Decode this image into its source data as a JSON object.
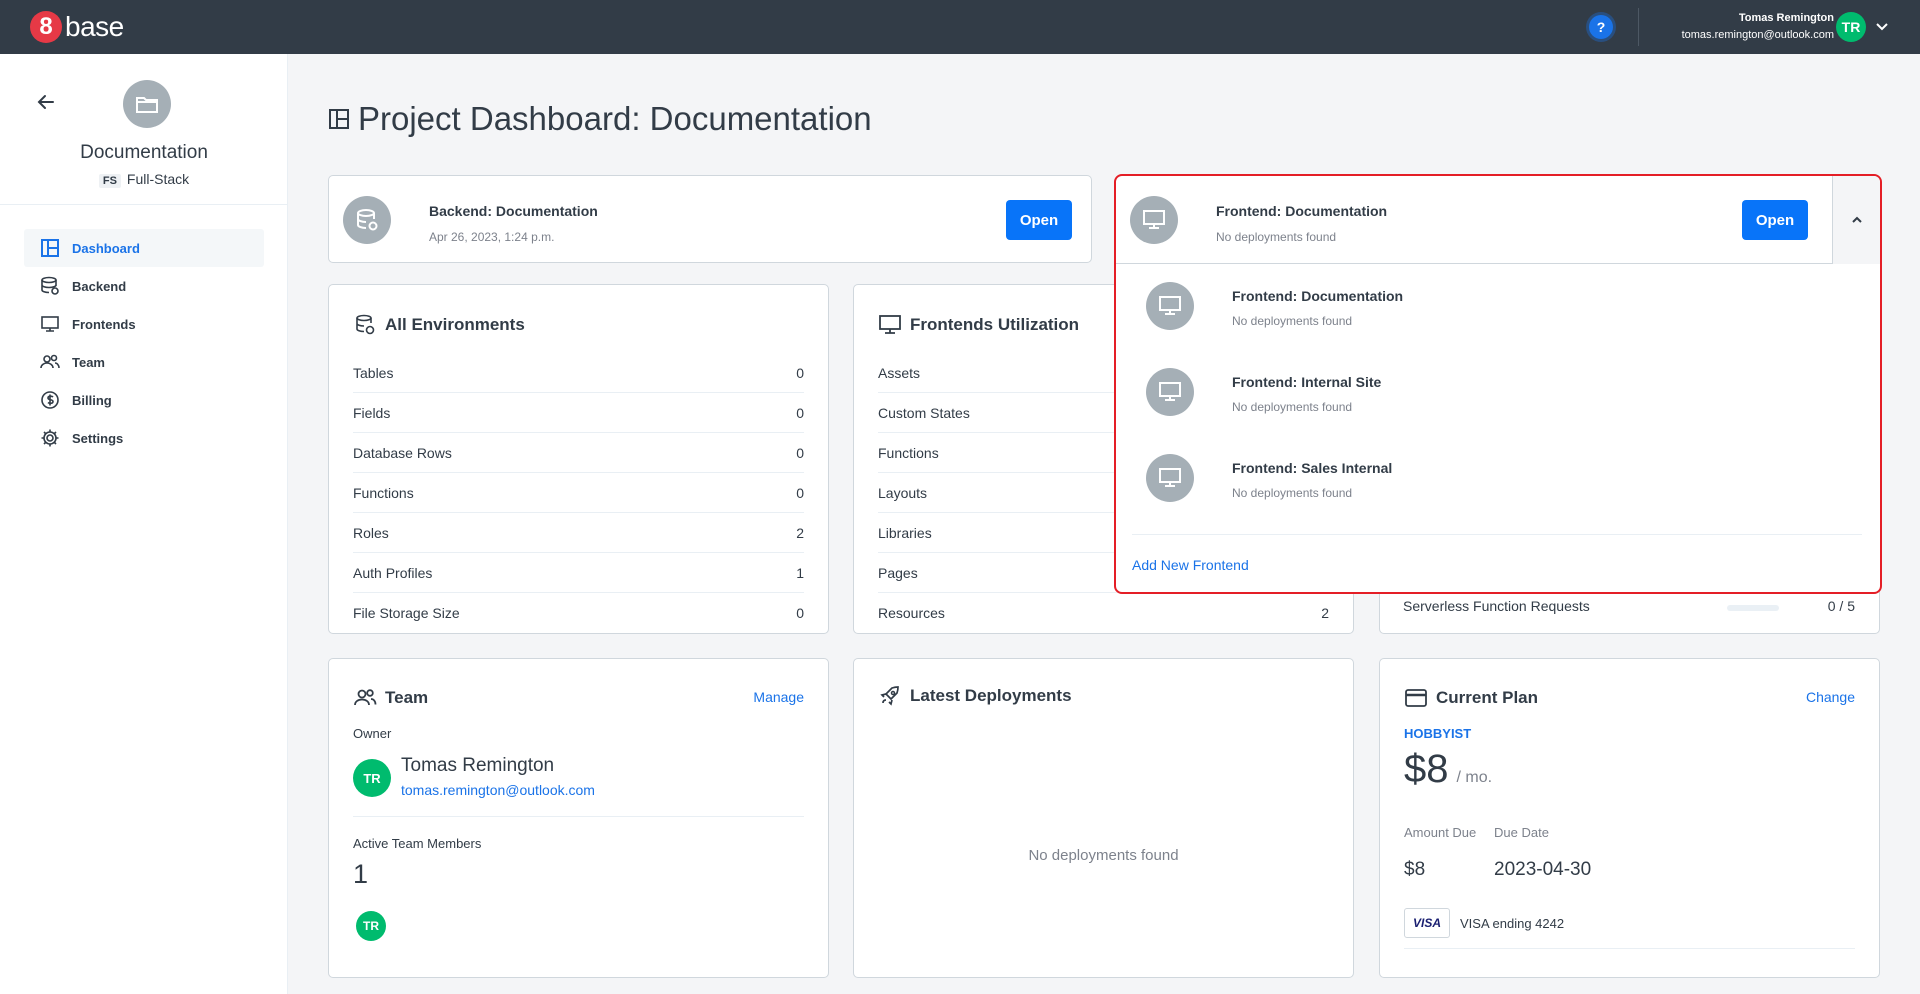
{
  "topbar": {
    "logo_digit": "8",
    "logo_text": "base",
    "help_label": "?",
    "user_name": "Tomas Remington",
    "user_email": "tomas.remington@outlook.com",
    "user_initials": "TR"
  },
  "sidebar": {
    "project_name": "Documentation",
    "project_badge": "FS",
    "project_type": "Full-Stack",
    "items": [
      {
        "label": "Dashboard",
        "icon": "dashboard-icon",
        "active": true
      },
      {
        "label": "Backend",
        "icon": "database-icon"
      },
      {
        "label": "Frontends",
        "icon": "monitor-icon"
      },
      {
        "label": "Team",
        "icon": "people-icon"
      },
      {
        "label": "Billing",
        "icon": "dollar-icon"
      },
      {
        "label": "Settings",
        "icon": "gear-icon"
      }
    ]
  },
  "page": {
    "title": "Project Dashboard: Documentation"
  },
  "backend_card": {
    "title": "Backend: Documentation",
    "subtitle": "Apr 26, 2023, 1:24 p.m.",
    "open_label": "Open"
  },
  "frontend_dropdown": {
    "title": "Frontend: Documentation",
    "subtitle": "No deployments found",
    "open_label": "Open",
    "items": [
      {
        "title": "Frontend: Documentation",
        "subtitle": "No deployments found"
      },
      {
        "title": "Frontend: Internal Site",
        "subtitle": "No deployments found"
      },
      {
        "title": "Frontend: Sales Internal",
        "subtitle": "No deployments found"
      }
    ],
    "add_label": "Add New Frontend"
  },
  "environments": {
    "title": "All Environments",
    "rows": [
      {
        "label": "Tables",
        "value": "0"
      },
      {
        "label": "Fields",
        "value": "0"
      },
      {
        "label": "Database Rows",
        "value": "0"
      },
      {
        "label": "Functions",
        "value": "0"
      },
      {
        "label": "Roles",
        "value": "2"
      },
      {
        "label": "Auth Profiles",
        "value": "1"
      },
      {
        "label": "File Storage Size",
        "value": "0"
      }
    ]
  },
  "frontends_util": {
    "title": "Frontends Utilization",
    "rows": [
      {
        "label": "Assets",
        "value": ""
      },
      {
        "label": "Custom States",
        "value": ""
      },
      {
        "label": "Functions",
        "value": ""
      },
      {
        "label": "Layouts",
        "value": ""
      },
      {
        "label": "Libraries",
        "value": ""
      },
      {
        "label": "Pages",
        "value": ""
      },
      {
        "label": "Resources",
        "value": "2"
      }
    ]
  },
  "usage": {
    "label": "Serverless Function Requests",
    "value": "0 / 5",
    "fraction": 0
  },
  "team": {
    "title": "Team",
    "manage_label": "Manage",
    "owner_label": "Owner",
    "owner_initials": "TR",
    "owner_name": "Tomas Remington",
    "owner_email": "tomas.remington@outlook.com",
    "members_label": "Active Team Members",
    "members_count": "1",
    "member_initials": "TR"
  },
  "deployments": {
    "title": "Latest Deployments",
    "empty": "No deployments found"
  },
  "plan": {
    "title": "Current Plan",
    "change_label": "Change",
    "plan_name": "HOBBYIST",
    "price": "$8",
    "period": "/ mo.",
    "amount_due_label": "Amount Due",
    "due_date_label": "Due Date",
    "amount_due": "$8",
    "due_date": "2023-04-30",
    "card_brand": "VISA",
    "card_text": "VISA ending 4242"
  },
  "colors": {
    "primary": "#0874f9",
    "topbar": "#323c47",
    "highlight": "#e41e26",
    "avatar": "#00bb6e"
  }
}
